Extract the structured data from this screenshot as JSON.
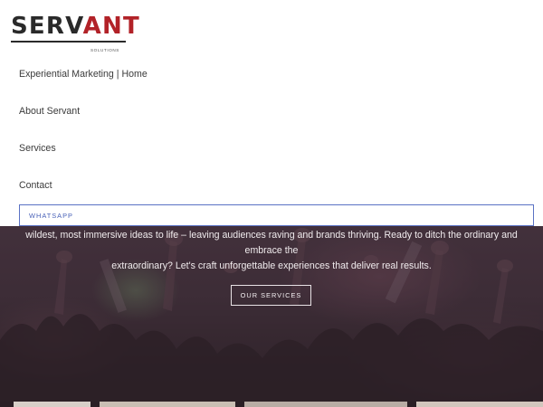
{
  "header": {
    "logo": {
      "word_dark": "SERV",
      "word_red": "ANT",
      "sub": "SOLUTIONS"
    }
  },
  "nav": {
    "items": [
      {
        "label": "Experiential Marketing | Home"
      },
      {
        "label": "About Servant"
      },
      {
        "label": "Services"
      },
      {
        "label": "Contact"
      }
    ],
    "whatsapp_label": "WHATSAPP"
  },
  "hero": {
    "line_1": "wildest, most immersive ideas to life – leaving audiences raving and brands thriving. Ready to ditch the ordinary and embrace the",
    "line_2": "extraordinary? Let's craft unforgettable experiences that deliver real results.",
    "button_label": "OUR SERVICES"
  },
  "colors": {
    "brand_red": "#b22228",
    "brand_dark": "#2a2a2a",
    "nav_text": "#3a3a3a",
    "whatsapp_accent": "#4a62b8",
    "hero_overlay": "#3f2e39"
  },
  "icons": []
}
